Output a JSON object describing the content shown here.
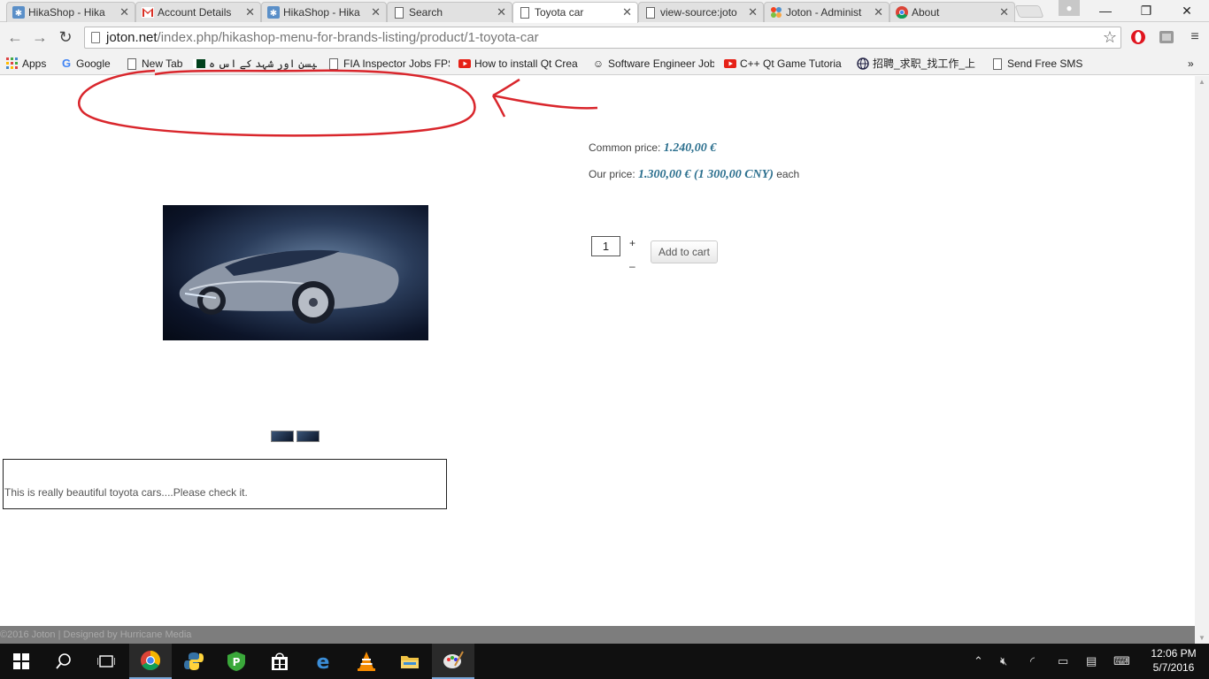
{
  "tabs": [
    {
      "label": "HikaShop - Hika",
      "icon": "hikashop-icon"
    },
    {
      "label": "Account Details",
      "icon": "gmail-icon"
    },
    {
      "label": "HikaShop - Hika",
      "icon": "hikashop-icon"
    },
    {
      "label": "Search",
      "icon": "page-icon"
    },
    {
      "label": "Toyota car",
      "icon": "page-icon",
      "active": true
    },
    {
      "label": "view-source:joto",
      "icon": "page-icon"
    },
    {
      "label": "Joton - Administ",
      "icon": "joomla-icon"
    },
    {
      "label": "About",
      "icon": "chrome-icon"
    }
  ],
  "omnibox": {
    "host": "joton.net",
    "path": "/index.php/hikashop-menu-for-brands-listing/product/1-toyota-car"
  },
  "bookmarks": [
    {
      "label": "Apps",
      "icon": "apps-grid-icon"
    },
    {
      "label": "Google",
      "icon": "google-icon"
    },
    {
      "label": "New Tab",
      "icon": "page-icon"
    },
    {
      "label": "لپسن اور شہد کے اس ہ",
      "icon": "pakistan-flag-icon"
    },
    {
      "label": "FIA Inspector Jobs FPS",
      "icon": "page-icon"
    },
    {
      "label": "How to install Qt Crea",
      "icon": "youtube-icon"
    },
    {
      "label": "Software Engineer Job",
      "icon": "jobs-icon"
    },
    {
      "label": "C++ Qt Game Tutoria",
      "icon": "youtube-icon"
    },
    {
      "label": "招聘_求职_找工作_上",
      "icon": "globe-icon"
    },
    {
      "label": "Send Free SMS",
      "icon": "page-icon"
    }
  ],
  "product": {
    "common_price_label": "Common price:",
    "common_price": "1.240,00 €",
    "our_price_label": "Our price:",
    "our_price": "1.300,00 € (1 300,00 CNY)",
    "per_unit": "each",
    "quantity": "1",
    "plus": "+",
    "minus": "–",
    "add_to_cart": "Add to cart",
    "description": "This is really beautiful toyota cars....Please check it."
  },
  "footer": {
    "text": "©2016 Joton | Designed by Hurricane Media"
  },
  "taskbar": {
    "apps": [
      "start-icon",
      "search-icon",
      "task-view-icon",
      "chrome-icon",
      "python-icon",
      "vpn-icon",
      "store-icon",
      "edge-icon",
      "vlc-icon",
      "file-explorer-icon",
      "paint-icon"
    ],
    "time": "12:06 PM",
    "date": "5/7/2016"
  },
  "colors": {
    "annotation": "#d9262c",
    "price": "#2b6f8e",
    "accent": "#7aa7d8"
  }
}
